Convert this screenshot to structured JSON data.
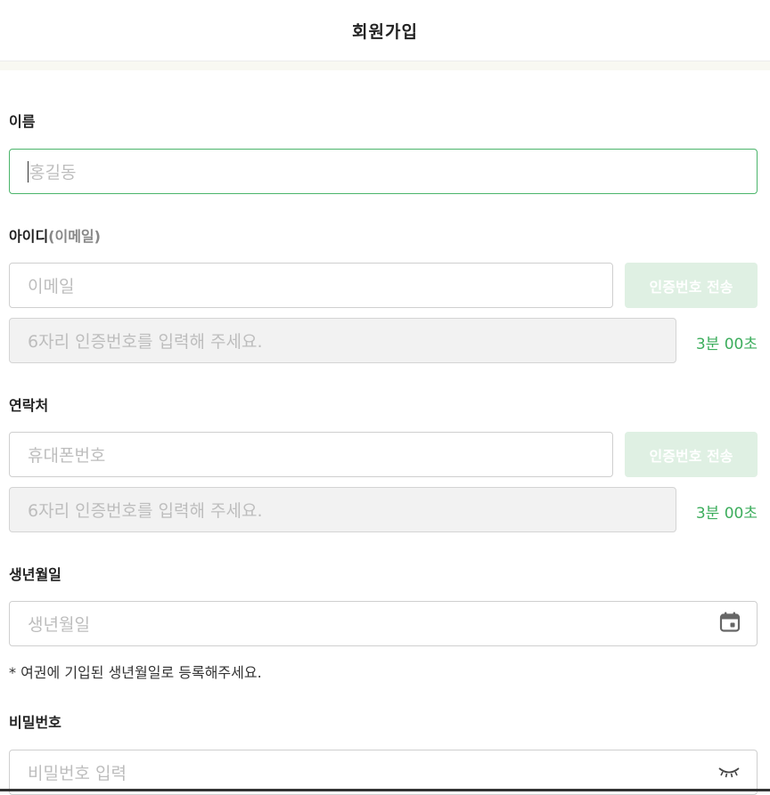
{
  "header": {
    "title": "회원가입"
  },
  "name": {
    "label": "이름",
    "placeholder": "홍길동"
  },
  "id": {
    "label": "아이디",
    "label_sub": "(이메일)",
    "email_placeholder": "이메일",
    "send_button": "인증번호 전송",
    "code_placeholder": "6자리 인증번호를 입력해 주세요.",
    "timer": "3분 00초"
  },
  "contact": {
    "label": "연락처",
    "phone_placeholder": "휴대폰번호",
    "send_button": "인증번호 전송",
    "code_placeholder": "6자리 인증번호를 입력해 주세요.",
    "timer": "3분 00초"
  },
  "birth": {
    "label": "생년월일",
    "placeholder": "생년월일",
    "icon": "calendar-icon",
    "note": "* 여권에 기입된 생년월일로 등록해주세요."
  },
  "password": {
    "label": "비밀번호",
    "placeholder": "비밀번호 입력",
    "icon": "eye-closed-icon"
  },
  "colors": {
    "accent": "#4bb56b",
    "timer": "#3cad5c",
    "button_disabled": "#dff0e3"
  }
}
